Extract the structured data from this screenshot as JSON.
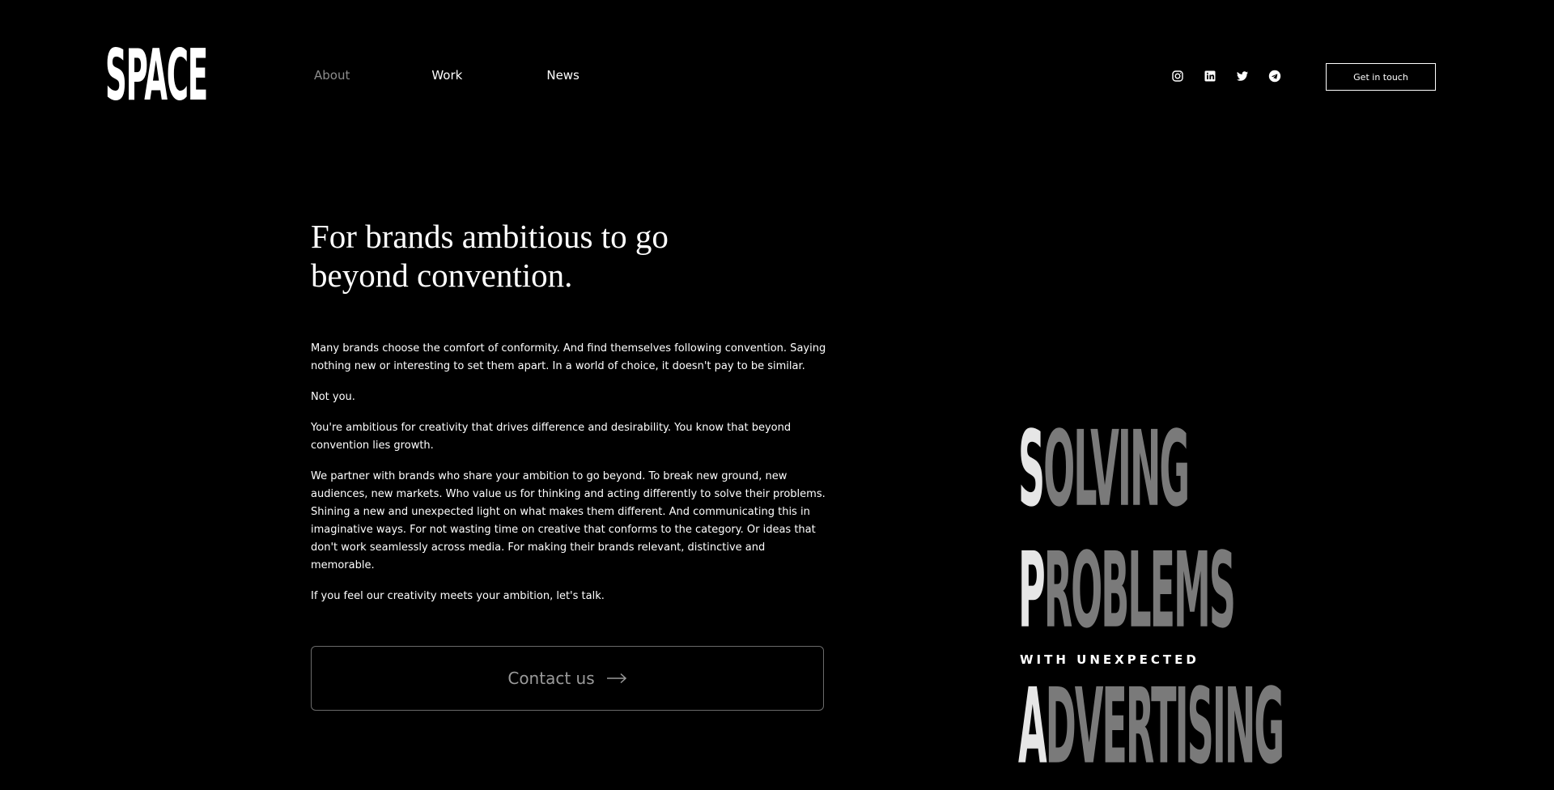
{
  "header": {
    "logo": "SPACE",
    "nav": {
      "about": "About",
      "work": "Work",
      "news": "News"
    },
    "socials": [
      "instagram-icon",
      "linkedin-icon",
      "twitter-icon",
      "telegram-icon"
    ],
    "cta_label": "Get in touch"
  },
  "main": {
    "headline": "For brands ambitious to go beyond convention.",
    "paragraphs": [
      "Many brands choose the comfort of conformity. And find themselves following convention. Saying nothing new or interesting to set them apart. In a world of choice, it doesn't pay to be similar.",
      "Not you.",
      "You're ambitious for creativity that drives difference and desirability. You know that beyond convention lies growth.",
      "We partner with brands who share your ambition to go beyond. To break new ground, new audiences, new markets. Who value us for thinking and acting differently to solve their problems. Shining a new and unexpected light on what makes them different. And communicating this in imaginative ways. For not wasting time on creative that conforms to the category. Or ideas that don't work seamlessly across media. For making their brands relevant, distinctive and memorable.",
      "If you feel our creativity meets your ambition, let's talk."
    ],
    "contact_label": "Contact us"
  },
  "tagline": {
    "line1_first": "S",
    "line1_rest": "OLVING",
    "line2_first": "P",
    "line2_rest": "ROBLEMS",
    "small": "WITH UNEXPECTED",
    "line3_first": "A",
    "line3_rest": "DVERTISING"
  },
  "colors": {
    "background": "#000000",
    "text": "#ffffff",
    "muted": "#8c8c8c",
    "tagline_dim": "#7a7a7a"
  }
}
